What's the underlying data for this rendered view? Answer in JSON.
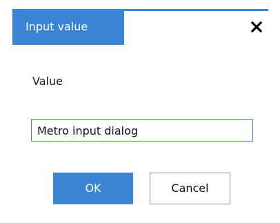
{
  "colors": {
    "accent": "#3a84d3"
  },
  "dialog": {
    "title": "Input value",
    "close_icon": "close-icon",
    "field_label": "Value",
    "input_value": "Metro input dialog",
    "ok_label": "OK",
    "cancel_label": "Cancel"
  }
}
